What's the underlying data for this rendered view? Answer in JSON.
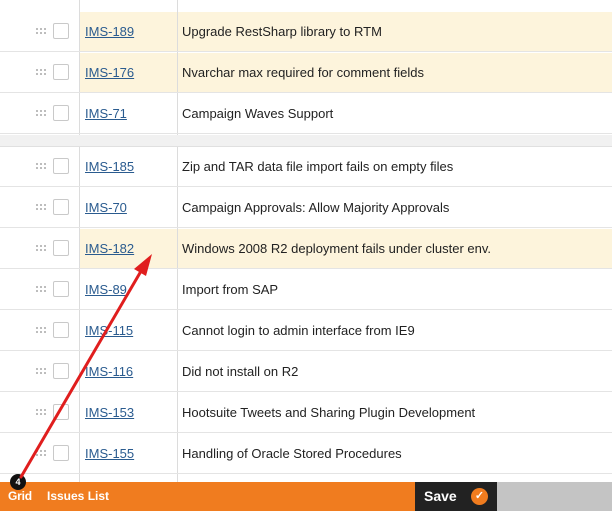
{
  "issues_group_1": [
    {
      "key": "IMS-189",
      "summary": "Upgrade RestSharp library to RTM",
      "highlighted": true
    },
    {
      "key": "IMS-176",
      "summary": "Nvarchar max required for comment fields",
      "highlighted": true
    },
    {
      "key": "IMS-71",
      "summary": "Campaign Waves Support",
      "highlighted": false
    }
  ],
  "issues_group_2": [
    {
      "key": "IMS-185",
      "summary": "Zip and TAR data file import fails on empty files",
      "highlighted": false
    },
    {
      "key": "IMS-70",
      "summary": "Campaign Approvals: Allow Majority Approvals",
      "highlighted": false
    },
    {
      "key": "IMS-182",
      "summary": "Windows 2008 R2 deployment fails under cluster env.",
      "highlighted": true
    },
    {
      "key": "IMS-89",
      "summary": "Import from SAP",
      "highlighted": false
    },
    {
      "key": "IMS-115",
      "summary": "Cannot login to admin interface from IE9",
      "highlighted": false
    },
    {
      "key": "IMS-116",
      "summary": "Did not install on R2",
      "highlighted": false
    },
    {
      "key": "IMS-153",
      "summary": "Hootsuite Tweets and Sharing Plugin Development",
      "highlighted": false
    },
    {
      "key": "IMS-155",
      "summary": "Handling of Oracle Stored Procedures",
      "highlighted": false
    }
  ],
  "bottom_bar": {
    "grid_tab_label": "Grid",
    "grid_badge": "4",
    "issues_list_tab_label": "Issues List",
    "save_label": "Save",
    "save_icon": "check-icon"
  },
  "colors": {
    "bar_orange": "#f07c1f",
    "highlight_row": "#fdf4dc",
    "link_blue": "#2a5b8f",
    "annotation_arrow": "#e01e1e"
  }
}
